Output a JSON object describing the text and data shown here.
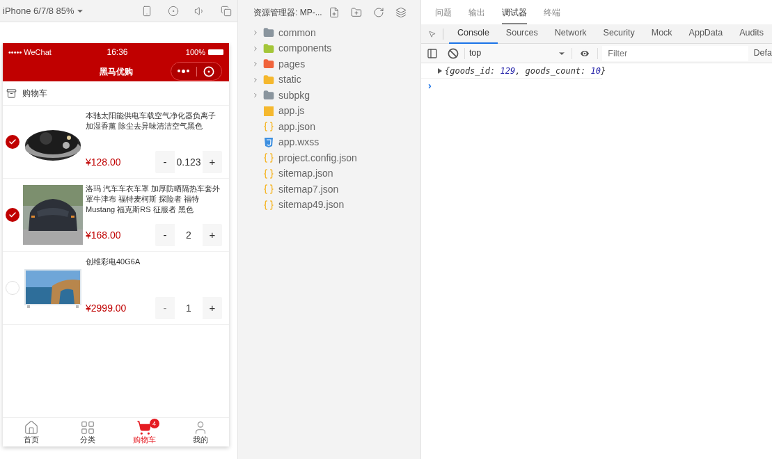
{
  "simulator": {
    "device": "iPhone 6/7/8 85%",
    "status_bar": {
      "carrier": "••••• WeChat",
      "time": "16:36",
      "battery": "100%"
    },
    "nav_title": "黑马优购",
    "cart_title": "购物车",
    "items": [
      {
        "title": "本驰太阳能供电车载空气净化器负离子加湿香薰 除尘去异味清洁空气黑色",
        "price": "¥128.00",
        "quantity": "0.123",
        "checked": true,
        "minus_disabled": false,
        "kind": "purifier"
      },
      {
        "title": "洛玛 汽车车衣车罩 加厚防晒隔热车套外罩牛津布 福特麦柯斯 探险者 福特Mustang 福克斯RS 征服者 黑色",
        "price": "¥168.00",
        "quantity": "2",
        "checked": true,
        "minus_disabled": false,
        "kind": "car"
      },
      {
        "title": "创维彩电40G6A",
        "price": "¥2999.00",
        "quantity": "1",
        "checked": false,
        "minus_disabled": true,
        "kind": "tv"
      }
    ],
    "minus": "-",
    "plus": "+",
    "tabbar": [
      {
        "label": "首页",
        "selected": false,
        "kind": "home"
      },
      {
        "label": "分类",
        "selected": false,
        "kind": "grid"
      },
      {
        "label": "购物车",
        "selected": true,
        "kind": "cart",
        "badge": "4"
      },
      {
        "label": "我的",
        "selected": false,
        "kind": "user"
      }
    ]
  },
  "explorer": {
    "title": "资源管理器: MP-...",
    "entries": [
      {
        "name": "common",
        "kind": "folder",
        "color": "#8a959e"
      },
      {
        "name": "components",
        "kind": "folder",
        "color": "#a4c639"
      },
      {
        "name": "pages",
        "kind": "folder",
        "color": "#f0643c"
      },
      {
        "name": "static",
        "kind": "folder",
        "color": "#f5b82e"
      },
      {
        "name": "subpkg",
        "kind": "folder",
        "color": "#8a959e"
      },
      {
        "name": "app.js",
        "kind": "js"
      },
      {
        "name": "app.json",
        "kind": "json"
      },
      {
        "name": "app.wxss",
        "kind": "wxss"
      },
      {
        "name": "project.config.json",
        "kind": "json"
      },
      {
        "name": "sitemap.json",
        "kind": "json"
      },
      {
        "name": "sitemap7.json",
        "kind": "json"
      },
      {
        "name": "sitemap49.json",
        "kind": "json"
      }
    ]
  },
  "devtools": {
    "top_tabs": [
      {
        "label": "问题",
        "selected": false
      },
      {
        "label": "输出",
        "selected": false
      },
      {
        "label": "调试器",
        "selected": true
      },
      {
        "label": "终端",
        "selected": false
      }
    ],
    "panel_tabs": [
      {
        "label": "Console",
        "selected": true
      },
      {
        "label": "Sources",
        "selected": false
      },
      {
        "label": "Network",
        "selected": false
      },
      {
        "label": "Security",
        "selected": false
      },
      {
        "label": "Mock",
        "selected": false
      },
      {
        "label": "AppData",
        "selected": false
      },
      {
        "label": "Audits",
        "selected": false
      }
    ],
    "context": "top",
    "filter_placeholder": "Filter",
    "levels": "Defa",
    "log": [
      {
        "text": "{goods_id: ",
        "kind": "plain"
      },
      {
        "text": "129",
        "kind": "number"
      },
      {
        "text": ", goods_count: ",
        "kind": "plain"
      },
      {
        "text": "10",
        "kind": "number"
      },
      {
        "text": "}",
        "kind": "plain"
      }
    ],
    "prompt": "›"
  }
}
